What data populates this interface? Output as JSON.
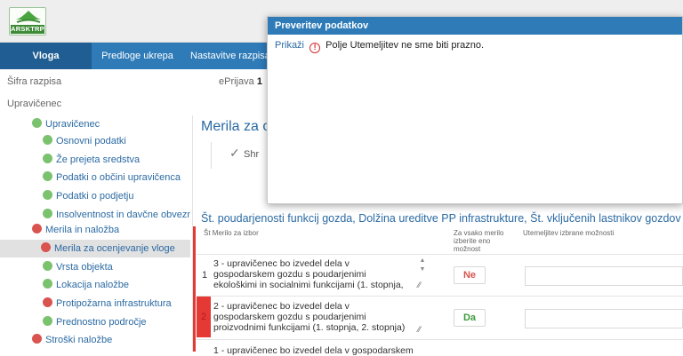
{
  "logo": {
    "text": "ARSKTRP"
  },
  "nav": {
    "items": [
      {
        "label": "Vloga",
        "active": true
      },
      {
        "label": "Predloge ukrepa",
        "active": false
      },
      {
        "label": "Nastavitve razpisa",
        "active": false
      }
    ]
  },
  "info": {
    "sifra_label": "Šifra razpisa",
    "eprijava_label": "ePrijava",
    "eprijava_value": "1",
    "upravicenec_label": "Upravičenec"
  },
  "sidebar": {
    "items": [
      {
        "label": "Upravičenec",
        "status": "green"
      },
      {
        "label": "Osnovni podatki",
        "status": "green"
      },
      {
        "label": "Že prejeta sredstva",
        "status": "green"
      },
      {
        "label": "Podatki o občini upravičenca",
        "status": "green"
      },
      {
        "label": "Podatki o podjetju",
        "status": "green"
      },
      {
        "label": "Insolventnost in davčne obvezn",
        "status": "green"
      },
      {
        "label": "Merila in naložba",
        "status": "red"
      },
      {
        "label": "Merila za ocenjevanje vloge",
        "status": "red"
      },
      {
        "label": "Vrsta objekta",
        "status": "green"
      },
      {
        "label": "Lokacija naložbe",
        "status": "green"
      },
      {
        "label": "Protipožarna infrastruktura",
        "status": "red"
      },
      {
        "label": "Prednostno področje",
        "status": "green"
      },
      {
        "label": "Stroški naložbe",
        "status": "red"
      }
    ]
  },
  "main": {
    "title": "Merila za o",
    "toolbar_label": "Shr",
    "section_title": "Št. poudarjenosti funkcij gozda, Dolžina ureditve PP infrastrukture, Št. vključenih lastnikov gozdov",
    "columns": {
      "merilo": "Št Merilo za izbor",
      "zavsako": "Za vsako merilo izberite eno možnost",
      "utemeljitev": "Utemeljitev izbrane možnosti"
    },
    "rows": [
      {
        "num": "1",
        "text": "3 - upravičenec bo izvedel dela v gospodarskem gozdu s poudarjenimi ekološkimi in socialnimi funkcijami (1. stopnja,",
        "choice": "Ne",
        "selected": false
      },
      {
        "num": "2",
        "text": "2 - upravičenec bo izvedel dela v gospodarskem gozdu s poudarjenimi proizvodnimi funkcijami (1. stopnja, 2. stopnja)",
        "choice": "Da",
        "selected": true
      },
      {
        "num": "",
        "text": "1 - upravičenec bo izvedel dela v gospodarskem",
        "choice": "",
        "selected": false
      }
    ]
  },
  "dialog": {
    "title": "Preveritev podatkov",
    "link": "Prikaži",
    "message": "Polje Utemeljitev ne sme biti prazno."
  },
  "colors": {
    "nav_blue": "#2e7bb8",
    "nav_active": "#1f5d92",
    "status_green": "#7bc26f",
    "status_red": "#d9534f",
    "selected_row": "#e53935"
  }
}
